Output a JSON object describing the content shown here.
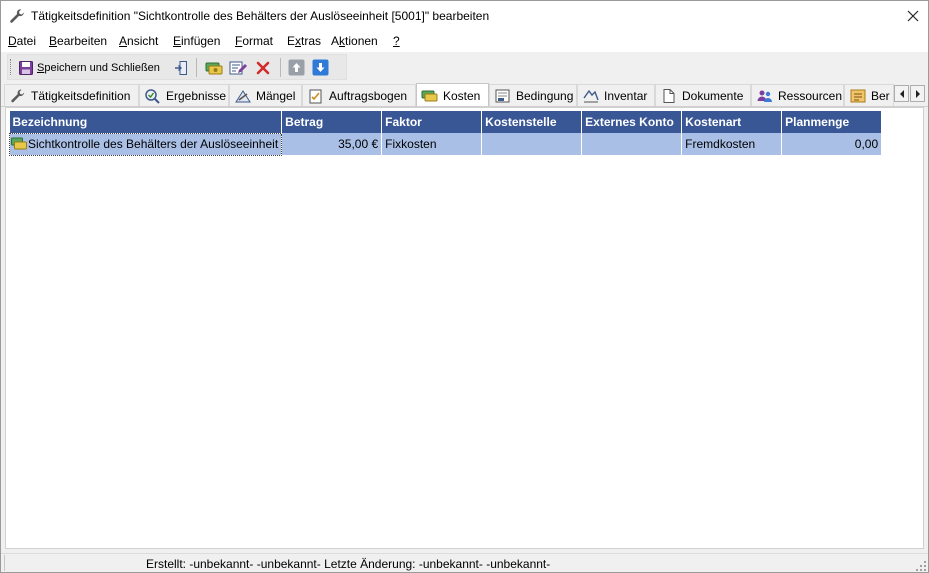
{
  "window": {
    "title": "Tätigkeitsdefinition \"Sichtkontrolle des Behälters der Auslöseeinheit [5001]\" bearbeiten",
    "icon": "wrench-icon"
  },
  "menu": [
    {
      "pre": "",
      "u": "D",
      "post": "atei"
    },
    {
      "pre": "",
      "u": "B",
      "post": "earbeiten"
    },
    {
      "pre": "",
      "u": "A",
      "post": "nsicht"
    },
    {
      "pre": "",
      "u": "E",
      "post": "infügen"
    },
    {
      "pre": "",
      "u": "F",
      "post": "ormat"
    },
    {
      "pre": "E",
      "u": "x",
      "post": "tras"
    },
    {
      "pre": "A",
      "u": "k",
      "post": "tionen"
    },
    {
      "pre": "",
      "u": "?",
      "post": ""
    }
  ],
  "toolbar": {
    "save_close": {
      "u": "S",
      "post": "peichern und Schließen"
    }
  },
  "tabs": [
    {
      "label": "Tätigkeitsdefinition",
      "icon": "wrench-icon"
    },
    {
      "label": "Ergebnisse",
      "icon": "results-icon"
    },
    {
      "label": "Mängel",
      "icon": "defects-icon"
    },
    {
      "label": "Auftragsbogen",
      "icon": "order-sheet-icon"
    },
    {
      "label": "Kosten",
      "icon": "costs-icon"
    },
    {
      "label": "Bedingung",
      "icon": "condition-icon"
    },
    {
      "label": "Inventar",
      "icon": "inventory-icon"
    },
    {
      "label": "Dokumente",
      "icon": "document-icon"
    },
    {
      "label": "Ressourcen",
      "icon": "resources-icon"
    },
    {
      "label": "Ber",
      "icon": "report-icon"
    }
  ],
  "grid": {
    "columns": [
      "Bezeichnung",
      "Betrag",
      "Faktor",
      "Kostenstelle",
      "Externes Konto",
      "Kostenart",
      "Planmenge"
    ],
    "rows": [
      [
        "Sichtkontrolle des Behälters der Auslöseeinheit",
        "35,00 €",
        "Fixkosten",
        "",
        "",
        "Fremdkosten",
        "0,00"
      ]
    ]
  },
  "status": {
    "text": "Erstellt: -unbekannt- -unbekannt-  Letzte Änderung: -unbekannt- -unbekannt-"
  },
  "colors": {
    "header_bg": "#3a5795",
    "row_selected_bg": "#a9bfe5"
  }
}
